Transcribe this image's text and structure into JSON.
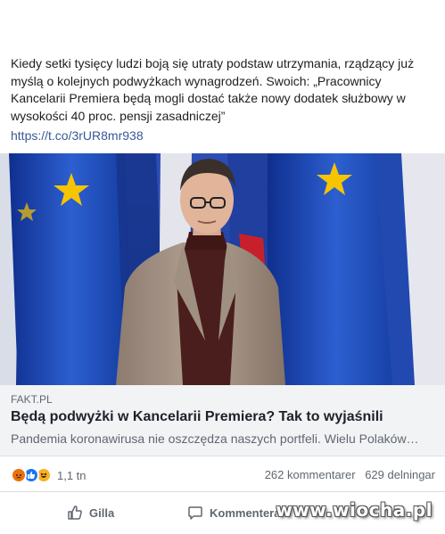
{
  "post": {
    "text": "Kiedy setki tysięcy ludzi boją się utraty podstaw utrzymania, rządzący już myślą o kolejnych podwyżkach wynagrodzeń. Swoich: „Pracownicy Kancelarii Premiera będą mogli dostać także nowy dodatek służbowy w wysokości 40 proc. pensji zasadniczej”",
    "link": "https://t.co/3rUR8mr938"
  },
  "link_preview": {
    "domain": "FAKT.PL",
    "title": "Będą podwyżki w Kancelarii Premiera? Tak to wyjaśnili",
    "description": "Pandemia koronawirusa nie oszczędza naszych portfeli. Wielu Polaków…"
  },
  "stats": {
    "reaction_count": "1,1 tn",
    "comments": "262 kommentarer",
    "shares": "629 delningar",
    "reaction_icons": [
      "angry-icon",
      "like-icon",
      "haha-icon"
    ]
  },
  "actions": {
    "like_label": "Gilla",
    "comment_label": "Kommentera"
  },
  "watermark": "www.wiocha.pl",
  "colors": {
    "link": "#385898",
    "meta_bg": "#f2f3f5",
    "muted": "#606770",
    "flag_blue": "#1a3ea8",
    "star_yellow": "#f6c400"
  }
}
